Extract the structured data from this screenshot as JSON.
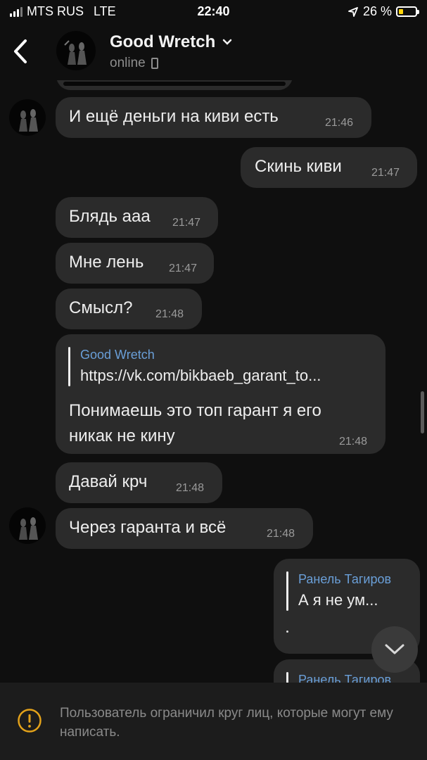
{
  "status_bar": {
    "carrier": "MTS RUS",
    "network": "LTE",
    "time": "22:40",
    "battery_percent": "26 %",
    "battery_level": 0.26,
    "battery_color": "#ffd60a"
  },
  "header": {
    "contact_name": "Good Wretch",
    "status": "online"
  },
  "messages": [
    {
      "text": "И ещё деньги на киви есть",
      "time": "21:46",
      "direction": "incoming"
    },
    {
      "text": "Скинь киви",
      "time": "21:47",
      "direction": "outgoing"
    },
    {
      "text": "Блядь ааа",
      "time": "21:47",
      "direction": "incoming"
    },
    {
      "text": "Мне лень",
      "time": "21:47",
      "direction": "incoming"
    },
    {
      "text": "Смысл?",
      "time": "21:48",
      "direction": "incoming"
    },
    {
      "reply_name": "Good Wretch",
      "reply_text": "https://vk.com/bikbaeb_garant_to...",
      "text_line1": "Понимаешь  это топ гарант я его",
      "text_line2": "никак не кину",
      "time": "21:48",
      "direction": "incoming"
    },
    {
      "text": "Давай крч",
      "time": "21:48",
      "direction": "incoming"
    },
    {
      "text": "Через гаранта и всё",
      "time": "21:48",
      "direction": "incoming"
    },
    {
      "reply_name": "Ранель Тагиров",
      "reply_text": "А я не ум...",
      "direction": "outgoing"
    },
    {
      "reply_name": "Ранель Тагиров",
      "direction": "outgoing"
    }
  ],
  "footer": {
    "notice": "Пользователь ограничил круг лиц, которые могут ему написать."
  },
  "colors": {
    "background": "#0f0f0f",
    "bubble": "#2b2b2b",
    "reply_name": "#6a9fd8",
    "footer": "#1c1c1c"
  },
  "icons": [
    "back-chevron-icon",
    "chevron-down-icon",
    "phone-icon",
    "scroll-down-icon",
    "warning-icon"
  ]
}
